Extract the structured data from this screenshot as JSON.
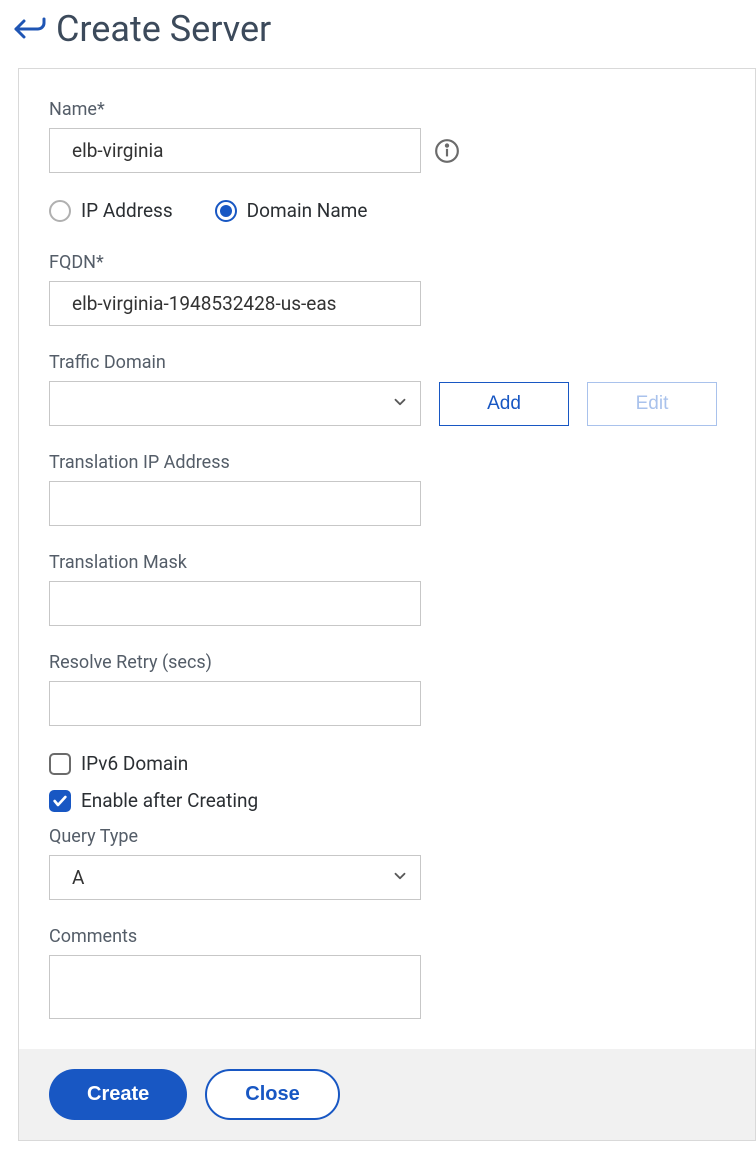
{
  "header": {
    "title": "Create Server"
  },
  "form": {
    "name_label": "Name*",
    "name_value": "elb-virginia",
    "radio_ip_label": "IP Address",
    "radio_domain_label": "Domain Name",
    "radio_selected": "domain",
    "fqdn_label": "FQDN*",
    "fqdn_value": "elb-virginia-1948532428-us-eas",
    "traffic_domain_label": "Traffic Domain",
    "traffic_domain_value": "",
    "add_label": "Add",
    "edit_label": "Edit",
    "translation_ip_label": "Translation IP Address",
    "translation_ip_value": "",
    "translation_mask_label": "Translation Mask",
    "translation_mask_value": "",
    "resolve_retry_label": "Resolve Retry (secs)",
    "resolve_retry_value": "",
    "ipv6_domain_label": "IPv6 Domain",
    "ipv6_domain_checked": false,
    "enable_after_label": "Enable after Creating",
    "enable_after_checked": true,
    "query_type_label": "Query Type",
    "query_type_value": "A",
    "comments_label": "Comments",
    "comments_value": ""
  },
  "footer": {
    "create_label": "Create",
    "close_label": "Close"
  }
}
